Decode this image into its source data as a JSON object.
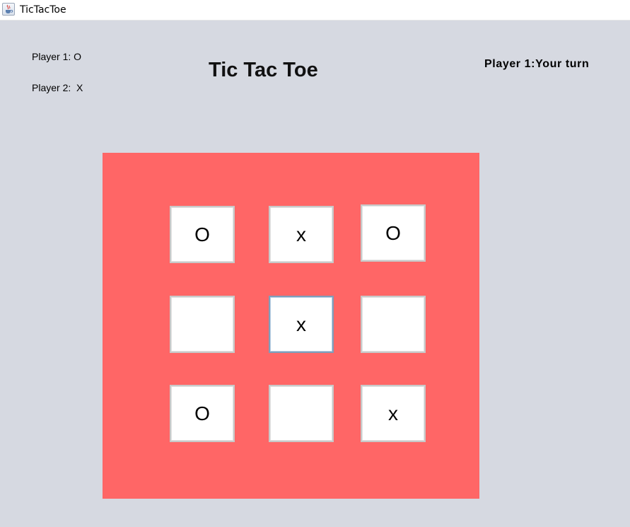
{
  "window": {
    "title": "TicTacToe",
    "icon": "java-cup-icon"
  },
  "header": {
    "player1_label": "Player 1: O",
    "player2_label": "Player 2:  X",
    "game_title": "Tic Tac Toe",
    "turn_status": "Player 1:Your turn"
  },
  "board": {
    "background_color": "#ff6666",
    "cells": [
      [
        "O",
        "x",
        "O"
      ],
      [
        "",
        "x",
        ""
      ],
      [
        "O",
        "",
        "x"
      ]
    ],
    "focused_cell": [
      1,
      1
    ]
  },
  "colors": {
    "window_background": "#d6d9e1",
    "cell_background": "#ffffff"
  }
}
